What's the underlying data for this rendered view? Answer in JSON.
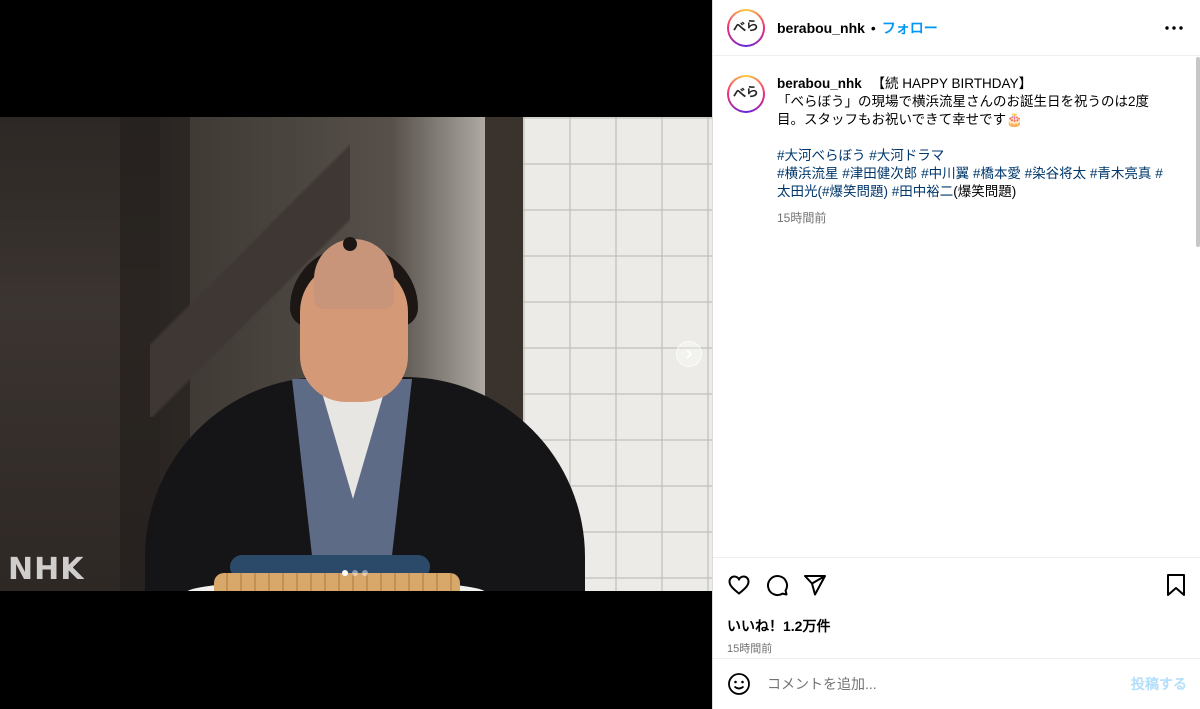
{
  "header": {
    "username": "berabou_nhk",
    "separator": "•",
    "follow_label": "フォロー",
    "avatar_text": "べら"
  },
  "media": {
    "watermark": "NHK",
    "carousel": {
      "total": 3,
      "active": 1
    }
  },
  "caption": {
    "username": "berabou_nhk",
    "title": "【続 HAPPY BIRTHDAY】",
    "text": "「べらぼう」の現場で横浜流星さんのお誕生日を祝うのは2度目。スタッフもお祝いできて幸せです🎂",
    "tags": [
      "#大河べらぼう",
      "#大河ドラマ",
      "#横浜流星",
      "#津田健次郎",
      "#中川翼",
      "#橋本愛",
      "#染谷将太",
      "#青木亮真",
      "#太田光"
    ],
    "tag_suffix_1": "(#爆笑問題)",
    "tag_last": "#田中裕二",
    "suffix_last": "(爆笑問題)",
    "time": "15時間前"
  },
  "actions": {
    "likes": "いいね！1.2万件",
    "time": "15時間前"
  },
  "comment": {
    "placeholder": "コメントを追加...",
    "post_label": "投稿する"
  }
}
